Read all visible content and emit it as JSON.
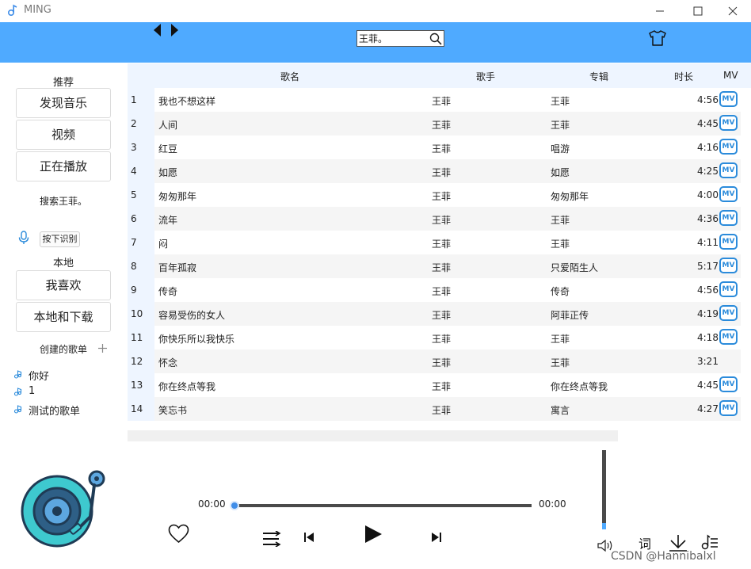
{
  "window": {
    "title": "MING",
    "icons": [
      "music-note-icon",
      "minimize-icon",
      "maximize-icon",
      "close-icon"
    ]
  },
  "topbar": {
    "search_value": "王菲。",
    "icons": [
      "back-arrow-icon",
      "forward-arrow-icon",
      "search-icon",
      "skin-icon"
    ],
    "accent": "#4faaff"
  },
  "sidebar": {
    "recommend_heading": "推荐",
    "discover_label": "发现音乐",
    "video_label": "视频",
    "now_playing_label": "正在播放",
    "search_status": "搜索王菲。",
    "voice_button": "按下识别",
    "local_heading": "本地",
    "favorites_label": "我喜欢",
    "local_download_label": "本地和下载",
    "created_playlists_heading": "创建的歌单",
    "playlists": [
      "你好",
      "1",
      "测试的歌单"
    ]
  },
  "table": {
    "columns": [
      "歌名",
      "歌手",
      "专辑",
      "时长",
      "MV"
    ],
    "mv_badge": "MV",
    "rows": [
      {
        "idx": "1",
        "name": "我也不想这样",
        "artist": "王菲",
        "album": "王菲",
        "duration": "4:56",
        "mv": true
      },
      {
        "idx": "2",
        "name": "人间",
        "artist": "王菲",
        "album": "王菲",
        "duration": "4:45",
        "mv": true
      },
      {
        "idx": "3",
        "name": "红豆",
        "artist": "王菲",
        "album": "唱游",
        "duration": "4:16",
        "mv": true
      },
      {
        "idx": "4",
        "name": "如愿",
        "artist": "王菲",
        "album": "如愿",
        "duration": "4:25",
        "mv": true
      },
      {
        "idx": "5",
        "name": "匆匆那年",
        "artist": "王菲",
        "album": "匆匆那年",
        "duration": "4:00",
        "mv": true
      },
      {
        "idx": "6",
        "name": "流年",
        "artist": "王菲",
        "album": "王菲",
        "duration": "4:36",
        "mv": true
      },
      {
        "idx": "7",
        "name": "闷",
        "artist": "王菲",
        "album": "王菲",
        "duration": "4:11",
        "mv": true
      },
      {
        "idx": "8",
        "name": "百年孤寂",
        "artist": "王菲",
        "album": "只爱陌生人",
        "duration": "5:17",
        "mv": true
      },
      {
        "idx": "9",
        "name": "传奇",
        "artist": "王菲",
        "album": "传奇",
        "duration": "4:56",
        "mv": true
      },
      {
        "idx": "10",
        "name": "容易受伤的女人",
        "artist": "王菲",
        "album": "阿菲正传",
        "duration": "4:19",
        "mv": true
      },
      {
        "idx": "11",
        "name": "你快乐所以我快乐",
        "artist": "王菲",
        "album": "王菲",
        "duration": "4:18",
        "mv": true
      },
      {
        "idx": "12",
        "name": "怀念",
        "artist": "王菲",
        "album": "王菲",
        "duration": "3:21",
        "mv": false
      },
      {
        "idx": "13",
        "name": "你在终点等我",
        "artist": "王菲",
        "album": "你在终点等我",
        "duration": "4:45",
        "mv": true
      },
      {
        "idx": "14",
        "name": "笑忘书",
        "artist": "王菲",
        "album": "寓言",
        "duration": "4:27",
        "mv": true
      }
    ]
  },
  "player": {
    "current_time": "00:00",
    "total_time": "00:00",
    "progress": 0,
    "volume": 0.08,
    "lyric_label": "词",
    "icons": [
      "vinyl-record-icon",
      "heart-icon",
      "playlist-mode-icon",
      "previous-icon",
      "play-icon",
      "next-icon",
      "volume-icon",
      "download-icon",
      "song-list-icon"
    ]
  },
  "watermark": "CSDN @Hannibalxl"
}
